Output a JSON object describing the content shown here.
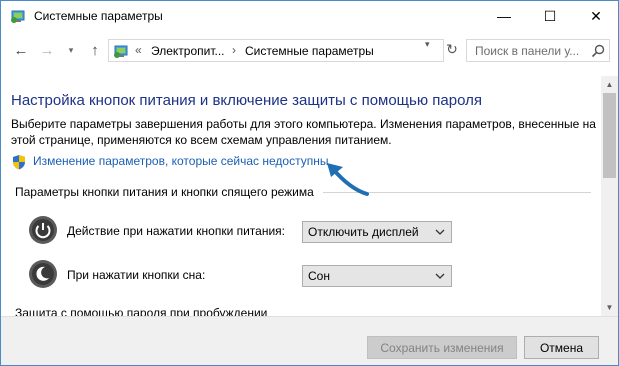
{
  "window": {
    "title": "Системные параметры"
  },
  "titlebar": {
    "minimize_glyph": "—",
    "maximize_glyph": "☐",
    "close_glyph": "✕",
    "icon": "control-panel-icon"
  },
  "nav": {
    "back_glyph": "←",
    "forward_glyph": "→",
    "recent_glyph": "▾",
    "up_glyph": "↑",
    "breadcrumb_separator_lead": "«",
    "breadcrumb_separator": "›",
    "breadcrumbs": [
      "Электропит...",
      "Системные параметры"
    ],
    "address_dropdown_glyph": "▾",
    "refresh_glyph": "↻"
  },
  "search": {
    "placeholder": "Поиск в панели у..."
  },
  "main": {
    "heading": "Настройка кнопок питания и включение защиты с помощью пароля",
    "description": "Выберите параметры завершения работы для этого компьютера. Изменения параметров, внесенные на этой странице, применяются ко всем схемам управления питанием.",
    "change_link": "Изменение параметров, которые сейчас недоступны",
    "section_power_title": "Параметры кнопки питания и кнопки спящего режима",
    "rows": [
      {
        "label": "Действие при нажатии кнопки питания:",
        "value": "Отключить дисплей",
        "icon": "power-button-icon"
      },
      {
        "label": "При нажатии кнопки сна:",
        "value": "Сон",
        "icon": "sleep-button-icon"
      }
    ],
    "section_password_title": "Защита с помощью пароля при пробуждении"
  },
  "footer": {
    "save_label": "Сохранить изменения",
    "cancel_label": "Отмена"
  },
  "colors": {
    "heading": "#1e3287",
    "link": "#1a5fb4",
    "arrow": "#1f6fb2",
    "window_border": "#4a8bc7"
  }
}
